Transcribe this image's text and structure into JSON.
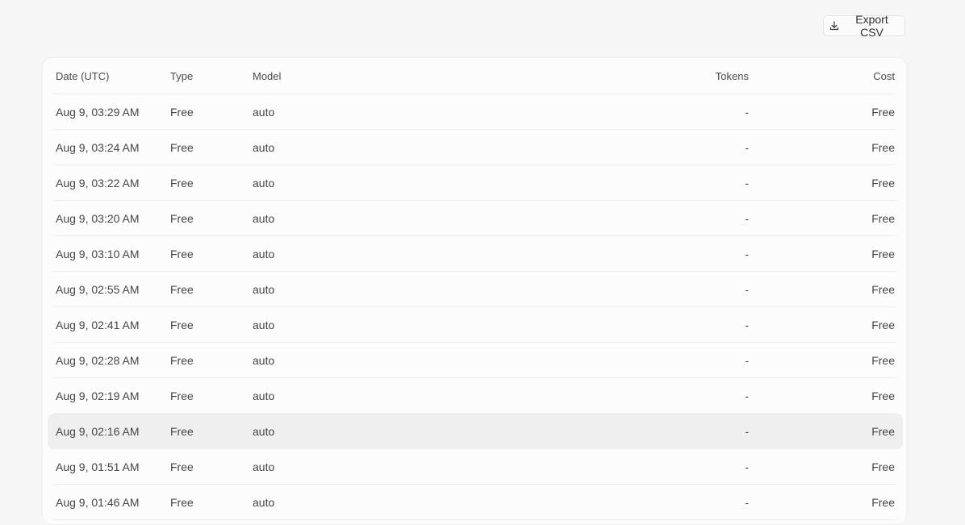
{
  "toolbar": {
    "export_label": "Export CSV",
    "export_icon": "download-icon"
  },
  "table": {
    "columns": [
      "Date (UTC)",
      "Type",
      "Model",
      "Tokens",
      "Cost"
    ],
    "rows": [
      {
        "date": "Aug 9, 03:29 AM",
        "type": "Free",
        "model": "auto",
        "tokens": "-",
        "cost": "Free"
      },
      {
        "date": "Aug 9, 03:24 AM",
        "type": "Free",
        "model": "auto",
        "tokens": "-",
        "cost": "Free"
      },
      {
        "date": "Aug 9, 03:22 AM",
        "type": "Free",
        "model": "auto",
        "tokens": "-",
        "cost": "Free"
      },
      {
        "date": "Aug 9, 03:20 AM",
        "type": "Free",
        "model": "auto",
        "tokens": "-",
        "cost": "Free"
      },
      {
        "date": "Aug 9, 03:10 AM",
        "type": "Free",
        "model": "auto",
        "tokens": "-",
        "cost": "Free"
      },
      {
        "date": "Aug 9, 02:55 AM",
        "type": "Free",
        "model": "auto",
        "tokens": "-",
        "cost": "Free"
      },
      {
        "date": "Aug 9, 02:41 AM",
        "type": "Free",
        "model": "auto",
        "tokens": "-",
        "cost": "Free"
      },
      {
        "date": "Aug 9, 02:28 AM",
        "type": "Free",
        "model": "auto",
        "tokens": "-",
        "cost": "Free"
      },
      {
        "date": "Aug 9, 02:19 AM",
        "type": "Free",
        "model": "auto",
        "tokens": "-",
        "cost": "Free"
      },
      {
        "date": "Aug 9, 02:16 AM",
        "type": "Free",
        "model": "auto",
        "tokens": "-",
        "cost": "Free"
      },
      {
        "date": "Aug 9, 01:51 AM",
        "type": "Free",
        "model": "auto",
        "tokens": "-",
        "cost": "Free"
      },
      {
        "date": "Aug 9, 01:46 AM",
        "type": "Free",
        "model": "auto",
        "tokens": "-",
        "cost": "Free"
      }
    ],
    "highlighted_row_index": 9
  },
  "colors": {
    "page_bg": "#f6f6f6",
    "card_bg": "#fcfcfc",
    "row_highlight": "#efefef",
    "divider": "#ececec",
    "text": "#454545"
  }
}
